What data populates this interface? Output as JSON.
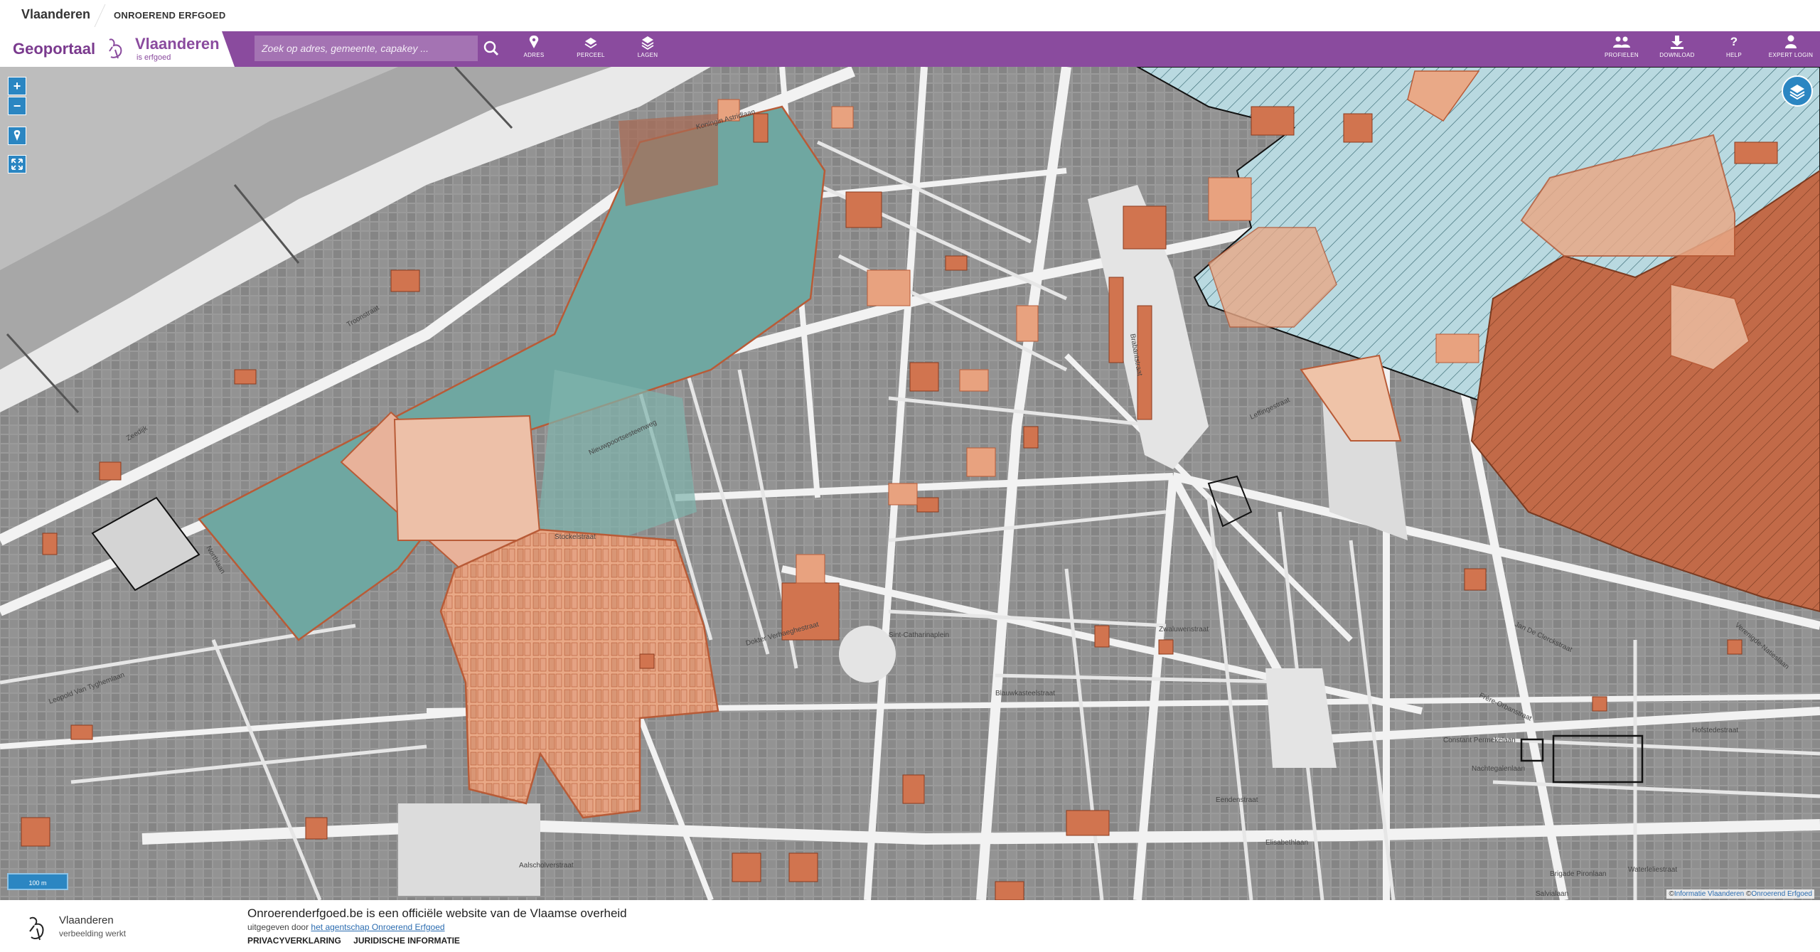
{
  "topbar": {
    "flemish_label": "Vlaanderen",
    "entity_label": "ONROEREND ERFGOED"
  },
  "header": {
    "app_title": "Geoportaal",
    "brand_name": "Vlaanderen",
    "brand_tagline": "is erfgoed",
    "search_placeholder": "Zoek op adres, gemeente, capakey ...",
    "nav": [
      {
        "label": "ADRES",
        "icon": "pin-icon"
      },
      {
        "label": "PERCEEL",
        "icon": "parcel-icon"
      },
      {
        "label": "LAGEN",
        "icon": "layers-icon"
      }
    ],
    "right_nav": [
      {
        "label": "PROFIELEN",
        "icon": "people-icon"
      },
      {
        "label": "DOWNLOAD",
        "icon": "download-icon"
      },
      {
        "label": "HELP",
        "icon": "help-icon"
      },
      {
        "label": "EXPERT LOGIN",
        "icon": "user-icon"
      }
    ]
  },
  "map": {
    "zoom_in": "+",
    "zoom_out": "−",
    "scale_label": "100 m",
    "attribution_prefix": "©",
    "attribution_link1": "Informatie Vlaanderen",
    "attribution_link2": "Onroerend Erfgoed",
    "colors": {
      "protected_zone": "#6fa7a1",
      "heritage_orange": "#e8a27f",
      "heritage_dark": "#c26a48",
      "hatch_zone": "#b9d9e0",
      "buildings": "#8d8d8d",
      "streets": "#f2f2f2"
    },
    "street_labels": [
      "Koningin Astridlaan",
      "Troonstraat",
      "Zeedijk",
      "Nieuwpoortsesteenweg",
      "Stockelstraat",
      "Brabantstraat",
      "Leffingestraat",
      "Elisabethlaan",
      "Dokter Verhaeghestraat",
      "Sint-Catharinaplein",
      "Zwaluwenstraat",
      "Constant Permekelaan",
      "Nachtegalenlaan",
      "Hofstedestraat",
      "Leopold Van Tyghemlaan",
      "Aalscholverstraat",
      "Brigade Piron­laan",
      "Waterleliestraat",
      "Salvialaan",
      "Verenigde-Natieslaan",
      "Frère-Orbanstraat",
      "Jan De Clerckstraat",
      "Blauwkasteelstraat",
      "Eendenstraat",
      "Northlaan"
    ]
  },
  "footer": {
    "brand_name": "Vlaanderen",
    "brand_tagline": "verbeelding werkt",
    "title": "Onroerenderfgoed.be is een officiële website van de Vlaamse overheid",
    "published_prefix": "uitgegeven door",
    "published_link": "het agentschap Onroerend Erfgoed",
    "links": [
      "PRIVACYVERKLARING",
      "JURIDISCHE INFORMATIE"
    ]
  }
}
